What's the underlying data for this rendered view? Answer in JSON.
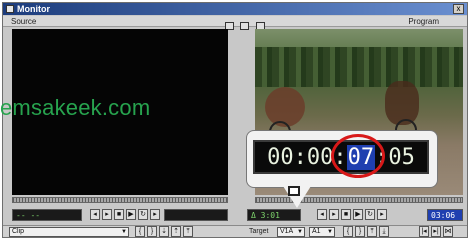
{
  "window": {
    "title": "Monitor",
    "close_glyph": "x"
  },
  "panels": {
    "source_label": "Source",
    "program_label": "Program"
  },
  "source_controls": {
    "timecode": "-- --"
  },
  "program_controls": {
    "timecode": "Δ 3:01",
    "timecode_right": "03:06"
  },
  "bottom": {
    "source_dropdown": "Clip",
    "target_label": "Target",
    "video_target": "V1A",
    "audio_target": "A1"
  },
  "callout": {
    "timecode_hours": "00",
    "timecode_minutes": "00",
    "timecode_seconds": "07",
    "timecode_frames": "05"
  },
  "watermark": {
    "text": "emsakeek.com"
  },
  "colors": {
    "accent_ring": "#d81818",
    "frames_highlight": "#1f3fb0",
    "watermark": "#27a34e"
  }
}
